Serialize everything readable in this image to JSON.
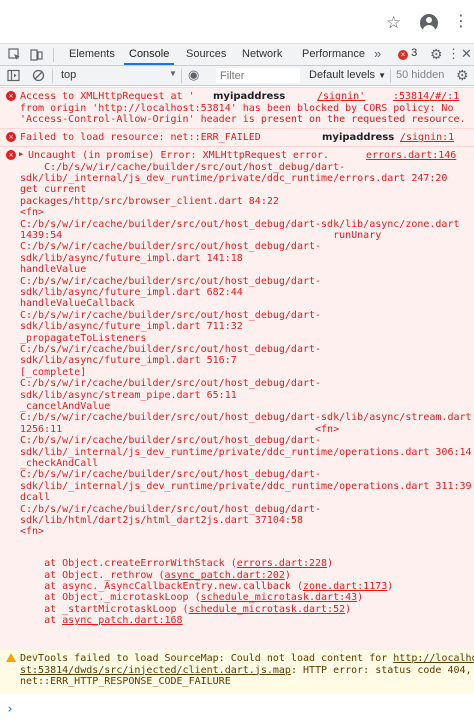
{
  "browser": {
    "star_icon": "star-outline-icon",
    "avatar_icon": "account-circle-icon",
    "menu_icon": "vertical-dots-icon"
  },
  "devtools": {
    "tabs": [
      {
        "label": "Elements",
        "active": false
      },
      {
        "label": "Console",
        "active": true
      },
      {
        "label": "Sources",
        "active": false
      },
      {
        "label": "Network",
        "active": false
      },
      {
        "label": "Performance",
        "active": false
      }
    ],
    "more_tabs": "»",
    "error_count": "3",
    "accent": "#1a73e8"
  },
  "toolbar": {
    "context": "top",
    "filter_placeholder": "Filter",
    "levels_label": "Default levels",
    "hidden_label": "50 hidden"
  },
  "messages": {
    "cors": {
      "lines": [
        "Access to XMLHttpRequest at '",
        "from origin 'http://localhost:53814' has been blocked by CORS policy: No",
        "'Access-Control-Allow-Origin' header is present on the requested resource."
      ],
      "host_label": "myipaddress",
      "src_a": "/signin'",
      "src_b": ":53814/#/:1"
    },
    "failed": {
      "text": "Failed to load resource: net::ERR_FAILED",
      "host_label": "myipaddress",
      "src": "/signin:1"
    },
    "uncaught": {
      "head": "Uncaught (in promise) Error: XMLHttpRequest error.",
      "src": "errors.dart:146",
      "lines": [
        "    C:/b/s/w/ir/cache/builder/src/out/host_debug/dart-",
        "sdk/lib/_internal/js_dev_runtime/private/ddc_runtime/errors.dart 247:20",
        "get current",
        "packages/http/src/browser_client.dart 84:22",
        "<fn>",
        "C:/b/s/w/ir/cache/builder/src/out/host_debug/dart-sdk/lib/async/zone.dart",
        "1439:54                                             runUnary",
        "C:/b/s/w/ir/cache/builder/src/out/host_debug/dart-",
        "sdk/lib/async/future_impl.dart 141:18",
        "handleValue",
        "C:/b/s/w/ir/cache/builder/src/out/host_debug/dart-",
        "sdk/lib/async/future_impl.dart 682:44",
        "handleValueCallback",
        "C:/b/s/w/ir/cache/builder/src/out/host_debug/dart-",
        "sdk/lib/async/future_impl.dart 711:32",
        "_propagateToListeners",
        "C:/b/s/w/ir/cache/builder/src/out/host_debug/dart-",
        "sdk/lib/async/future_impl.dart 516:7",
        "[_complete]",
        "C:/b/s/w/ir/cache/builder/src/out/host_debug/dart-",
        "sdk/lib/async/stream_pipe.dart 65:11",
        "_cancelAndValue",
        "C:/b/s/w/ir/cache/builder/src/out/host_debug/dart-sdk/lib/async/stream.dart",
        "1256:11                                          <fn>",
        "C:/b/s/w/ir/cache/builder/src/out/host_debug/dart-",
        "sdk/lib/_internal/js_dev_runtime/private/ddc_runtime/operations.dart 306:14",
        "_checkAndCall",
        "C:/b/s/w/ir/cache/builder/src/out/host_debug/dart-",
        "sdk/lib/_internal/js_dev_runtime/private/ddc_runtime/operations.dart 311:39",
        "dcall",
        "C:/b/s/w/ir/cache/builder/src/out/host_debug/dart-",
        "sdk/lib/html/dart2js/html_dart2js.dart 37104:58",
        "<fn>"
      ],
      "stack": [
        {
          "prefix": "    at Object.createErrorWithStack (",
          "link": "errors.dart:228",
          "suffix": ")"
        },
        {
          "prefix": "    at Object._rethrow (",
          "link": "async_patch.dart:202",
          "suffix": ")"
        },
        {
          "prefix": "    at async._AsyncCallbackEntry.new.callback (",
          "link": "zone.dart:1173",
          "suffix": ")"
        },
        {
          "prefix": "    at Object._microtaskLoop (",
          "link": "schedule_microtask.dart:43",
          "suffix": ")"
        },
        {
          "prefix": "    at _startMicrotaskLoop (",
          "link": "schedule_microtask.dart:52",
          "suffix": ")"
        },
        {
          "prefix": "    at ",
          "link": "async_patch.dart:168",
          "suffix": ""
        }
      ]
    },
    "warning": {
      "pre": "DevTools failed to load SourceMap: Could not load content for ",
      "link_a": "http://localho",
      "link_b": "st:53814/dwds/src/injected/client.dart.js.map",
      "post_b": ": HTTP error: status code 404,",
      "line3": "net::ERR_HTTP_RESPONSE_CODE_FAILURE"
    }
  },
  "prompt": "›"
}
